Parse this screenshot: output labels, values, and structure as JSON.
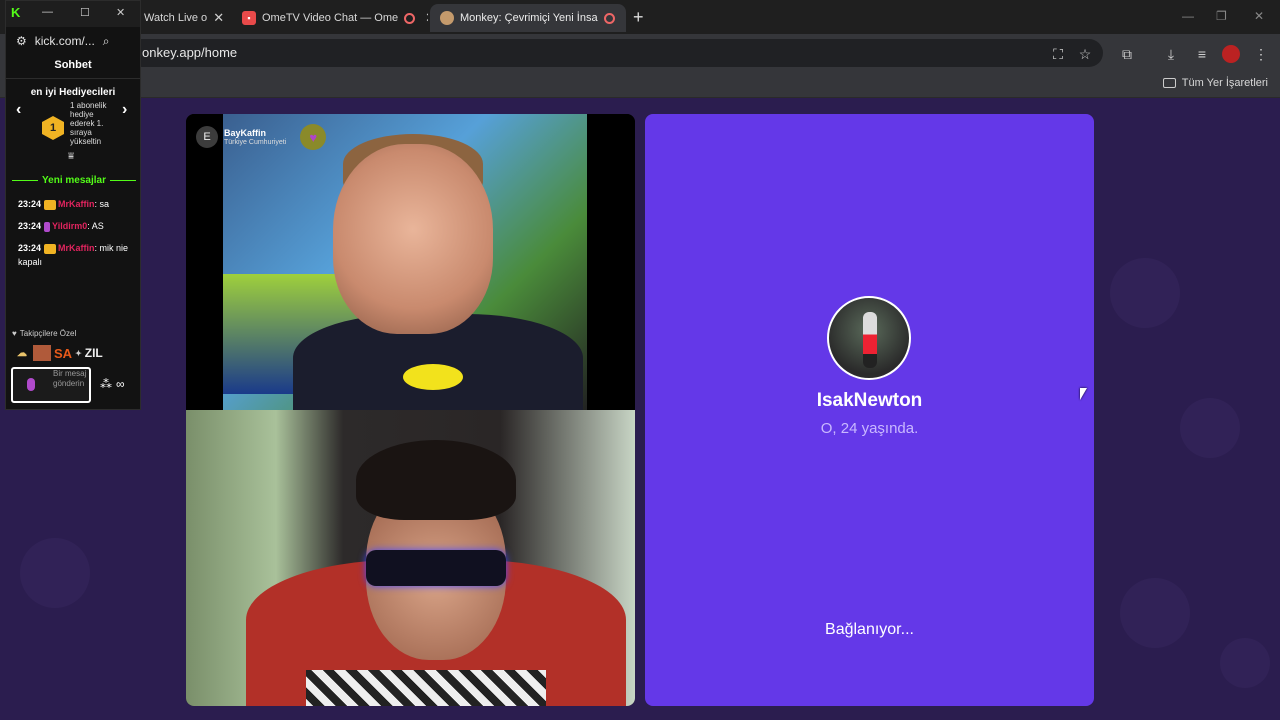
{
  "browser": {
    "tabs": [
      {
        "title": "Watch Live o",
        "active": false
      },
      {
        "title": "OmeTV Video Chat — Ome",
        "active": false
      },
      {
        "title": "Monkey: Çevrimiçi Yeni İnsa",
        "active": true
      }
    ],
    "url": "onkey.app/home",
    "bookmarks_folder": "Tüm Yer İşaretleri"
  },
  "kick_overlay": {
    "url": "kick.com/...",
    "title": "Sohbet",
    "gifters_title": "en iyi Hediyecileri",
    "gifter_rank": "1",
    "gifter_desc": "1 abonelik hediye ederek 1. sıraya yükseltin",
    "new_messages": "Yeni mesajlar",
    "messages": [
      {
        "time": "23:24",
        "user": "MrKaffin",
        "text": ": sa",
        "user_color": "#e0245e"
      },
      {
        "time": "23:24",
        "user": "Yildirm0",
        "text": ": AS",
        "user_color": "#e0245e"
      },
      {
        "time": "23:24",
        "user": "MrKaffin",
        "text": ": mik nie kapalı",
        "user_color": "#e0245e"
      }
    ],
    "followers_only": "Takipçilere Özel",
    "emotes": [
      "SA",
      "ZIL"
    ],
    "input_placeholder": "Bir mesaj gönderin"
  },
  "video": {
    "remote_avatar_letter": "E",
    "remote_user": "BayKaffin",
    "remote_country": "Türkiye Cumhuriyeti"
  },
  "match_panel": {
    "name": "IsakNewton",
    "age_text": "O, 24 yaşında.",
    "status": "Bağlanıyor...",
    "bg_color": "#6438e8"
  }
}
